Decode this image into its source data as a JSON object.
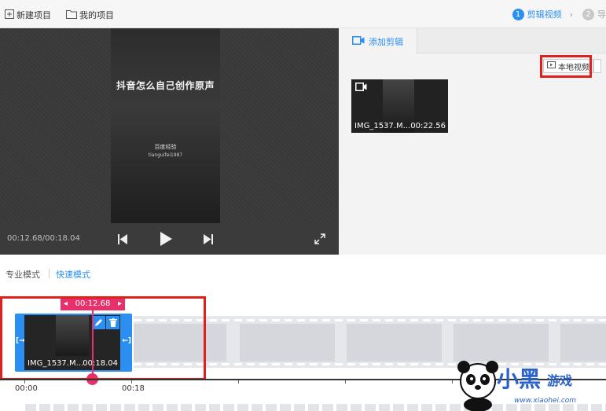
{
  "topbar": {
    "new_project_label": "新建项目",
    "my_projects_label": "我的项目",
    "step1_num": "1",
    "step1_label": "剪辑视频",
    "step2_num": "2",
    "step2_label": "导"
  },
  "preview": {
    "frame_title": "抖音怎么自己创作原声",
    "frame_sub1": "百度经验",
    "frame_sub2": "tianguifei1987",
    "timecode": "00:12.68/00:18.04"
  },
  "right_panel": {
    "tab_label": "添加剪辑",
    "local_video_label": "本地视频",
    "media": [
      {
        "name": "IMG_1537.M...",
        "duration": "00:22.56"
      }
    ]
  },
  "modes": {
    "pro_label": "专业模式",
    "quick_label": "快速模式"
  },
  "timeline": {
    "playhead_time": "00:12.68",
    "clip_name": "IMG_1537.M...",
    "clip_duration": "00:18.04",
    "ruler_labels": [
      "00:00",
      "00:18"
    ]
  },
  "watermark": {
    "brand_main": "小黑",
    "brand_sub": "游戏",
    "url": "www.xiaohei.com"
  },
  "colors": {
    "accent": "#2a8ff0",
    "playhead": "#e8316b",
    "highlight": "#e0201c"
  }
}
